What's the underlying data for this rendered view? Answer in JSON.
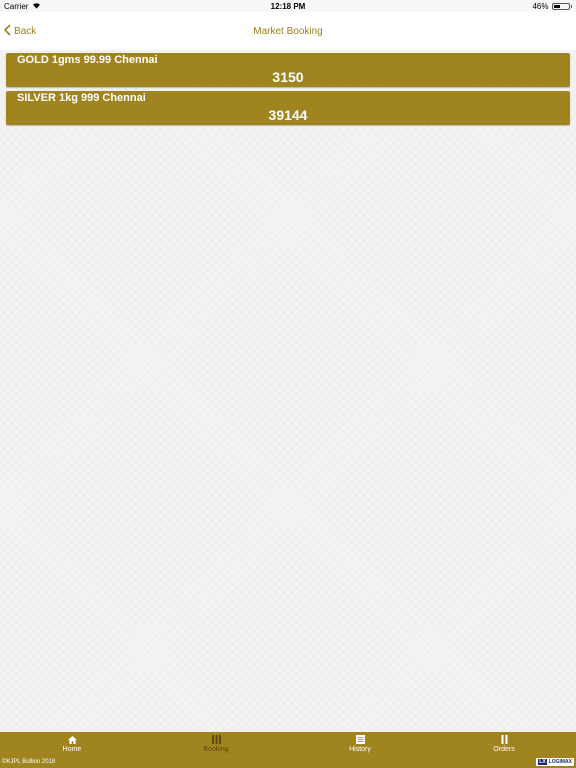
{
  "status_bar": {
    "carrier": "Carrier",
    "time": "12:18 PM",
    "battery": "46%",
    "battery_level": 0.46
  },
  "nav": {
    "back_label": "Back",
    "title": "Market Booking"
  },
  "products": [
    {
      "name": "GOLD 1gms 99.99 Chennai",
      "price": "3150"
    },
    {
      "name": "SILVER 1kg 999 Chennai",
      "price": "39144"
    }
  ],
  "tabs": [
    {
      "label": "Home",
      "icon": "home-icon"
    },
    {
      "label": "Booking",
      "icon": "booking-icon"
    },
    {
      "label": "History",
      "icon": "history-icon"
    },
    {
      "label": "Orders",
      "icon": "orders-icon"
    }
  ],
  "footer": {
    "copyright": "©KJPL Bullion 2018",
    "logo_mark": "LX",
    "logo_text": "LOGIMAX"
  },
  "colors": {
    "accent": "#a08420",
    "title": "#9a7f1b",
    "active_tab": "#5b4a10"
  }
}
